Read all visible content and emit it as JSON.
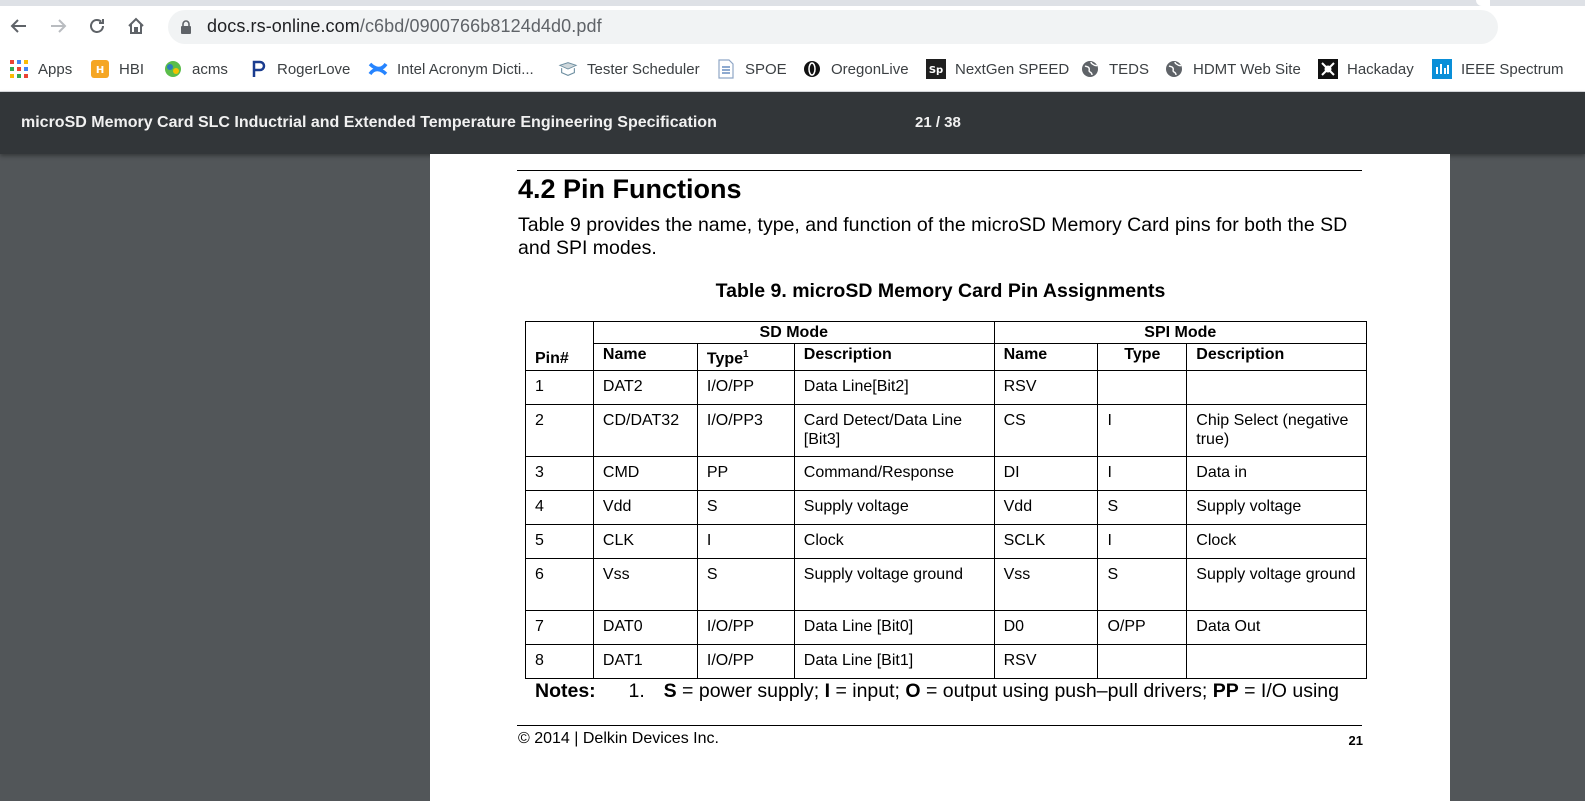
{
  "browser": {
    "url_host": "docs.rs-online.com",
    "url_path": "/c6bd/0900766b8124d4d0.pdf",
    "bookmarks": [
      {
        "label": "Apps",
        "icon": "apps-grid-icon"
      },
      {
        "label": "HBI",
        "icon": "hbi-icon"
      },
      {
        "label": "acms",
        "icon": "acms-icon"
      },
      {
        "label": "RogerLove",
        "icon": "rogerlove-icon"
      },
      {
        "label": "Intel Acronym Dicti...",
        "icon": "confluence-icon"
      },
      {
        "label": "Tester Scheduler",
        "icon": "tester-scheduler-icon"
      },
      {
        "label": "SPOE",
        "icon": "document-icon"
      },
      {
        "label": "OregonLive",
        "icon": "oregonlive-icon"
      },
      {
        "label": "NextGen SPEED",
        "icon": "sp-icon"
      },
      {
        "label": "TEDS",
        "icon": "globe-icon"
      },
      {
        "label": "HDMT Web Site",
        "icon": "globe-icon"
      },
      {
        "label": "Hackaday",
        "icon": "hackaday-icon"
      },
      {
        "label": "IEEE Spectrum",
        "icon": "ieee-icon"
      }
    ]
  },
  "pdf": {
    "title": "microSD Memory Card SLC Inductrial and Extended Temperature Engineering Specification",
    "page_indicator": "21 / 38"
  },
  "document": {
    "heading": "4.2 Pin Functions",
    "intro": "Table 9 provides the name, type, and function of the microSD Memory Card pins for both the SD and SPI modes.",
    "table_caption": "Table 9. microSD Memory Card Pin Assignments",
    "table": {
      "pin_header": "Pin#",
      "sd_group": "SD Mode",
      "spi_group": "SPI Mode",
      "sd_headers": {
        "name": "Name",
        "type": "Type",
        "type_sup": "1",
        "description": "Description"
      },
      "spi_headers": {
        "name": "Name",
        "type": "Type",
        "description": "Description"
      },
      "rows": [
        {
          "pin": "1",
          "sd_name": "DAT2",
          "sd_type": "I/O/PP",
          "sd_desc": "Data Line[Bit2]",
          "spi_name": "RSV",
          "spi_type": "",
          "spi_desc": ""
        },
        {
          "pin": "2",
          "sd_name": "CD/DAT32",
          "sd_type": "I/O/PP3",
          "sd_desc": "Card Detect/Data Line [Bit3]",
          "spi_name": "CS",
          "spi_type": "I",
          "spi_desc": "Chip Select (negative true)"
        },
        {
          "pin": "3",
          "sd_name": "CMD",
          "sd_type": "PP",
          "sd_desc": "Command/Response",
          "spi_name": "DI",
          "spi_type": "I",
          "spi_desc": "Data in"
        },
        {
          "pin": "4",
          "sd_name": "Vdd",
          "sd_type": "S",
          "sd_desc": "Supply voltage",
          "spi_name": "Vdd",
          "spi_type": "S",
          "spi_desc": "Supply voltage"
        },
        {
          "pin": "5",
          "sd_name": "CLK",
          "sd_type": "I",
          "sd_desc": "Clock",
          "spi_name": "SCLK",
          "spi_type": "I",
          "spi_desc": "Clock"
        },
        {
          "pin": "6",
          "sd_name": "Vss",
          "sd_type": "S",
          "sd_desc": "Supply voltage ground",
          "spi_name": "Vss",
          "spi_type": "S",
          "spi_desc": "Supply voltage ground"
        },
        {
          "pin": "7",
          "sd_name": "DAT0",
          "sd_type": "I/O/PP",
          "sd_desc": "Data Line [Bit0]",
          "spi_name": "D0",
          "spi_type": "O/PP",
          "spi_desc": "Data Out"
        },
        {
          "pin": "8",
          "sd_name": "DAT1",
          "sd_type": "I/O/PP",
          "sd_desc": "Data Line [Bit1]",
          "spi_name": "RSV",
          "spi_type": "",
          "spi_desc": ""
        }
      ]
    },
    "notes": {
      "label": "Notes:",
      "item_number": "1.",
      "parts": [
        {
          "bold": "S",
          "text": " = power supply; "
        },
        {
          "bold": "I",
          "text": " = input; "
        },
        {
          "bold": "O",
          "text": " = output using push–pull drivers; "
        },
        {
          "bold": "PP",
          "text": " = I/O using"
        }
      ]
    },
    "footer_copyright": "© 2014 | Delkin Devices Inc.",
    "footer_page": "21"
  }
}
